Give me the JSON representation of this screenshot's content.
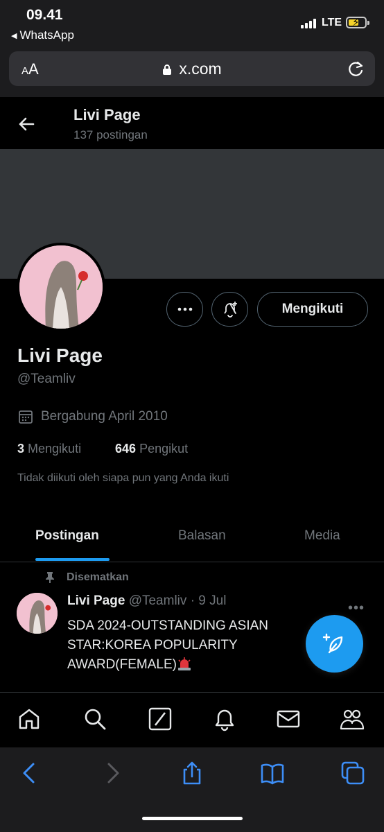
{
  "status_bar": {
    "time": "09.41",
    "back_app": "WhatsApp",
    "network": "LTE"
  },
  "browser": {
    "text_size_label_small": "A",
    "text_size_label_large": "A",
    "url": "x.com"
  },
  "header": {
    "name": "Livi Page",
    "post_count": "137 postingan"
  },
  "profile": {
    "name": "Livi Page",
    "handle": "@Teamliv",
    "joined": "Bergabung April 2010",
    "following_count": "3",
    "following_label": "Mengikuti",
    "followers_count": "646",
    "followers_label": "Pengikut",
    "not_followed_text": "Tidak diikuti oleh siapa pun yang Anda ikuti",
    "follow_button": "Mengikuti"
  },
  "tabs": [
    {
      "label": "Postingan",
      "active": true
    },
    {
      "label": "Balasan",
      "active": false
    },
    {
      "label": "Media",
      "active": false
    }
  ],
  "pinned_post": {
    "pinned_label": "Disematkan",
    "author": "Livi Page",
    "handle": "@Teamliv",
    "separator": "·",
    "date": "9 Jul",
    "text": "SDA 2024-OUTSTANDING ASIAN STAR:KOREA POPULARITY AWARD(FEMALE)"
  },
  "colors": {
    "accent": "#1d9bf0",
    "banner": "#333639",
    "muted_text": "#71767b",
    "safari_blue": "#3d8ef7"
  },
  "icons": {
    "bottom_nav": [
      "home-icon",
      "search-icon",
      "grok-icon",
      "notifications-icon",
      "messages-icon",
      "communities-icon"
    ],
    "safari_toolbar": [
      "back-icon",
      "forward-icon",
      "share-icon",
      "bookmarks-icon",
      "tabs-icon"
    ]
  }
}
